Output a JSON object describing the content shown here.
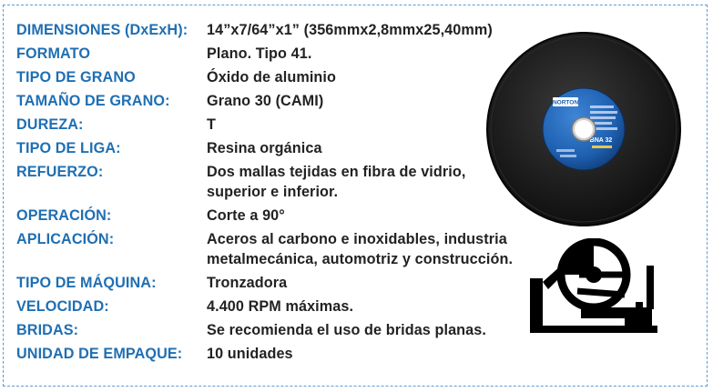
{
  "specs": [
    {
      "label": "DIMENSIONES (DxExH):",
      "lines": [
        "14”x7/64”x1” (356mmx2,8mmx25,40mm)"
      ]
    },
    {
      "label": "FORMATO",
      "lines": [
        "Plano. Tipo 41."
      ]
    },
    {
      "label": "TIPO DE GRANO",
      "lines": [
        "Óxido de aluminio"
      ]
    },
    {
      "label": "TAMAÑO DE GRANO:",
      "lines": [
        "Grano 30 (CAMI)"
      ]
    },
    {
      "label": "DUREZA:",
      "lines": [
        "T"
      ]
    },
    {
      "label": "TIPO DE LIGA:",
      "lines": [
        "Resina orgánica"
      ]
    },
    {
      "label": "REFUERZO:",
      "lines": [
        "Dos mallas tejidas en fibra de vidrio,",
        "superior e inferior."
      ]
    },
    {
      "label": "OPERACIÓN:",
      "lines": [
        "Corte a 90°"
      ]
    },
    {
      "label": "APLICACIÓN:",
      "lines": [
        "Aceros al carbono e inoxidables, industria",
        "metalmecánica, automotriz y construcción."
      ]
    },
    {
      "label": "TIPO DE MÁQUINA:",
      "lines": [
        "Tronzadora"
      ]
    },
    {
      "label": "VELOCIDAD:",
      "lines": [
        "4.400 RPM máximas."
      ]
    },
    {
      "label": "BRIDAS:",
      "lines": [
        "Se recomienda el uso de bridas planas."
      ]
    },
    {
      "label": "UNIDAD DE EMPAQUE:",
      "lines": [
        "10 unidades"
      ]
    }
  ],
  "disc_label": {
    "brand": "NORTON",
    "product": "BNA 32"
  },
  "icons": {
    "disc": "cutting-disc-photo",
    "machine": "chop-saw-icon"
  },
  "colors": {
    "label": "#1f6fb3",
    "value": "#222222",
    "border": "#5b9bd5",
    "disc": "#1a1a1a",
    "disc_label": "#1e5fb0"
  }
}
